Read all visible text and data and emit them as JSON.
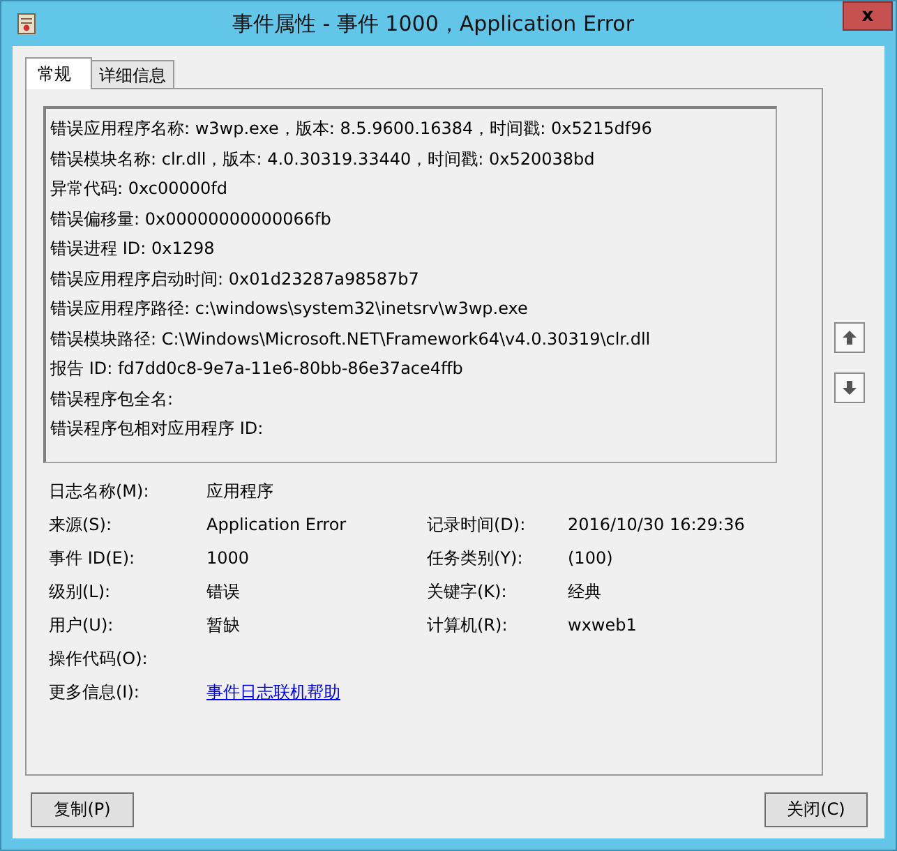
{
  "window": {
    "title": "事件属性 - 事件 1000，Application Error",
    "close_glyph": "x"
  },
  "tabs": [
    {
      "label": "常规",
      "selected": true
    },
    {
      "label": "详细信息",
      "selected": false
    }
  ],
  "description": [
    "错误应用程序名称: w3wp.exe，版本: 8.5.9600.16384，时间戳: 0x5215df96",
    "错误模块名称: clr.dll，版本: 4.0.30319.33440，时间戳: 0x520038bd",
    "异常代码: 0xc00000fd",
    "错误偏移量: 0x00000000000066fb",
    "错误进程 ID: 0x1298",
    "错误应用程序启动时间: 0x01d23287a98587b7",
    "错误应用程序路径: c:\\windows\\system32\\inetsrv\\w3wp.exe",
    "错误模块路径: C:\\Windows\\Microsoft.NET\\Framework64\\v4.0.30319\\clr.dll",
    "报告 ID: fd7dd0c8-9e7a-11e6-80bb-86e37ace4ffb",
    "错误程序包全名:",
    "错误程序包相对应用程序 ID:"
  ],
  "rows": [
    {
      "left": {
        "label": "日志名称(M):",
        "value": "应用程序",
        "kind": "text"
      }
    },
    {
      "left": {
        "label": "来源(S):",
        "value": "Application Error",
        "kind": "text"
      },
      "right": {
        "label": "记录时间(D):",
        "value": "2016/10/30 16:29:36",
        "kind": "text"
      }
    },
    {
      "left": {
        "label": "事件 ID(E):",
        "value": "1000",
        "kind": "text"
      },
      "right": {
        "label": "任务类别(Y):",
        "value": "(100)",
        "kind": "text"
      }
    },
    {
      "left": {
        "label": "级别(L):",
        "value": "错误",
        "kind": "text"
      },
      "right": {
        "label": "关键字(K):",
        "value": "经典",
        "kind": "text"
      }
    },
    {
      "left": {
        "label": "用户(U):",
        "value": "暂缺",
        "kind": "text"
      },
      "right": {
        "label": "计算机(R):",
        "value": "wxweb1",
        "kind": "text"
      }
    },
    {
      "left": {
        "label": "操作代码(O):"
      }
    },
    {
      "left": {
        "label": "更多信息(I):",
        "value": "事件日志联机帮助",
        "kind": "link"
      }
    }
  ],
  "buttons": [
    "复制(P)",
    "关闭(C)"
  ]
}
